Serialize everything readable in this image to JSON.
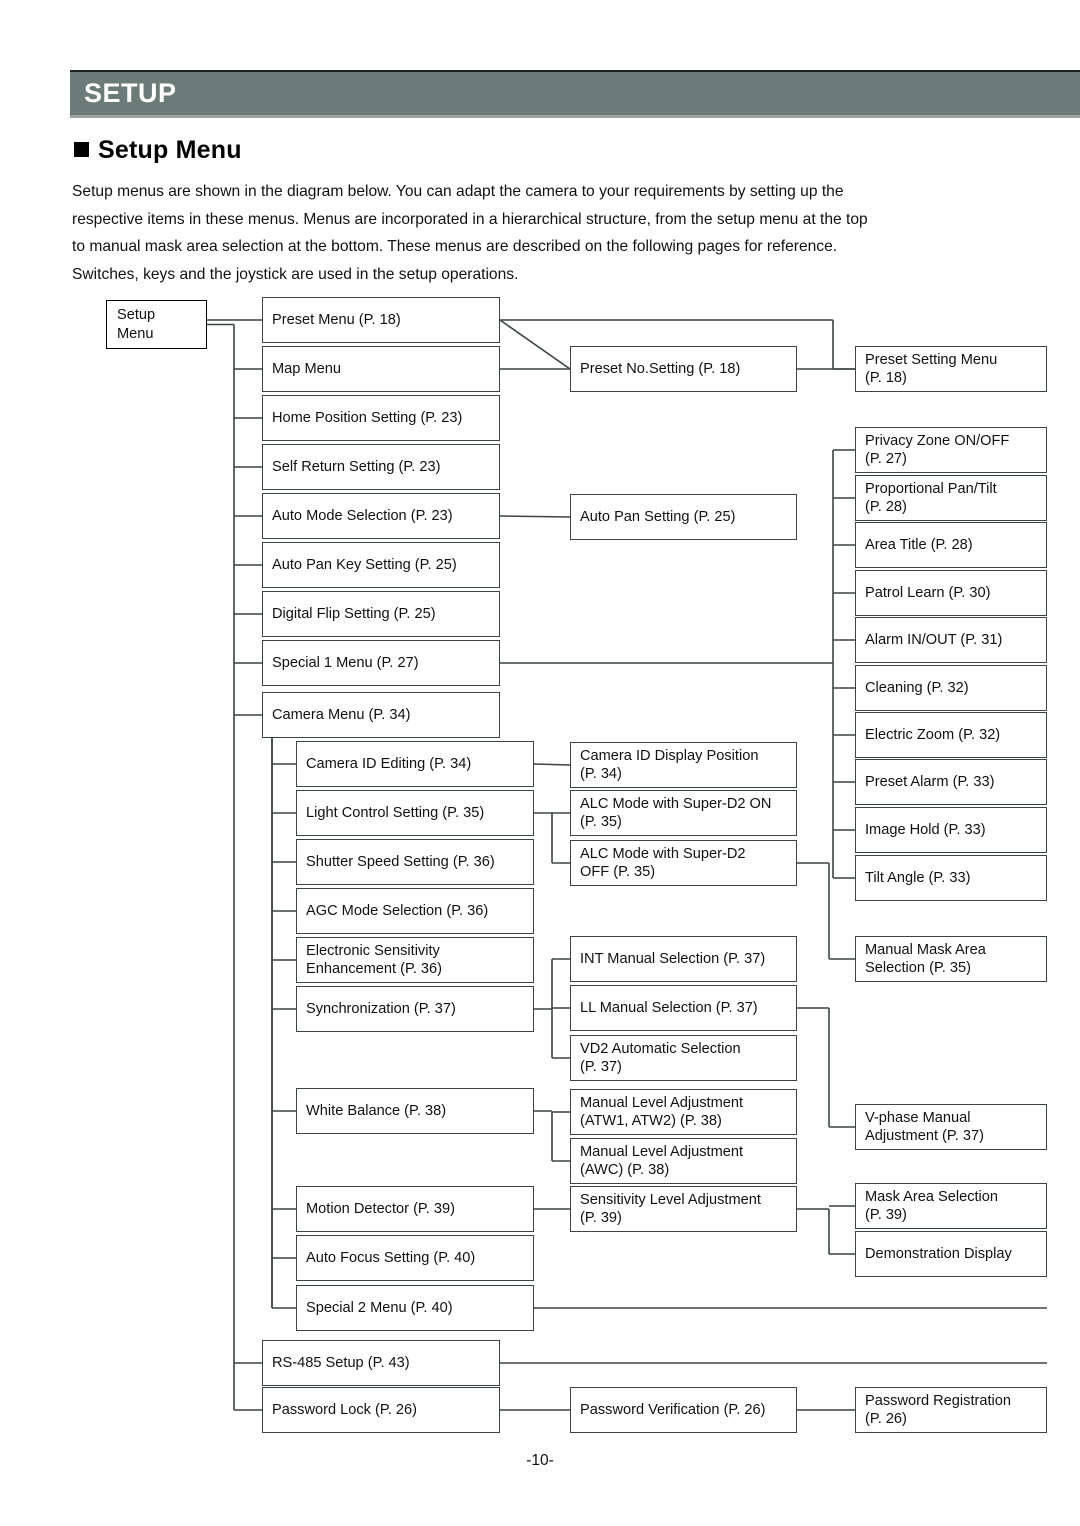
{
  "header": {
    "title": "SETUP"
  },
  "section": {
    "heading": "Setup Menu",
    "bullet_icon": "filled-square-bullet"
  },
  "intro": {
    "line1": "Setup menus are shown in the diagram below. You can adapt the camera to your requirements by setting up the",
    "line2": "respective items in these menus.  Menus are incorporated in a hierarchical structure, from the setup menu at the top",
    "line3": "to manual mask area selection at the bottom. These menus are described on the following pages for reference.",
    "line4": "Switches, keys and the joystick are used in the setup operations."
  },
  "footer": {
    "page_number": "-10-"
  },
  "diagram": {
    "root": {
      "label": "Setup\nMenu"
    },
    "column1": [
      {
        "label": "Preset Menu (P.  18)"
      },
      {
        "label": "Map Menu"
      },
      {
        "label": "Home Position Setting (P.  23)"
      },
      {
        "label": "Self Return Setting (P.  23)"
      },
      {
        "label": "Auto Mode Selection (P.  23)"
      },
      {
        "label": "Auto Pan Key Setting (P.  25)"
      },
      {
        "label": "Digital Flip Setting (P.  25)"
      },
      {
        "label": "Special 1 Menu (P.  27)"
      },
      {
        "label": "Camera Menu (P.  34)"
      },
      {
        "label": "RS-485 Setup (P.  43)"
      },
      {
        "label": "Password Lock (P.  26)"
      }
    ],
    "column2": [
      {
        "label": "Camera ID Editing (P.  34)"
      },
      {
        "label": "Light Control Setting (P.  35)"
      },
      {
        "label": "Shutter Speed Setting (P.  36)"
      },
      {
        "label": "AGC Mode Selection (P.  36)"
      },
      {
        "label": "Electronic Sensitivity\nEnhancement (P.  36)"
      },
      {
        "label": "Synchronization (P.  37)"
      },
      {
        "label": "White Balance (P.  38)"
      },
      {
        "label": "Motion Detector (P.  39)"
      },
      {
        "label": "Auto Focus Setting (P.  40)"
      },
      {
        "label": "Special 2 Menu (P.  40)"
      }
    ],
    "column3": [
      {
        "label": "Preset No.Setting (P.  18)"
      },
      {
        "label": "Auto Pan Setting (P.  25)"
      },
      {
        "label": "Camera ID Display Position\n(P.  34)"
      },
      {
        "label": "ALC Mode with Super-D2 ON\n(P.  35)"
      },
      {
        "label": "ALC Mode with Super-D2\nOFF (P.  35)"
      },
      {
        "label": "INT Manual Selection (P.  37)"
      },
      {
        "label": "LL Manual Selection (P.  37)"
      },
      {
        "label": "VD2 Automatic Selection\n(P.  37)"
      },
      {
        "label": "Manual Level Adjustment\n(ATW1, ATW2) (P.  38)"
      },
      {
        "label": "Manual Level Adjustment\n(AWC) (P.  38)"
      },
      {
        "label": "Sensitivity Level Adjustment\n(P.  39)"
      },
      {
        "label": "Password Verification (P.  26)"
      }
    ],
    "column4": [
      {
        "label": "Preset Setting Menu\n(P.  18)"
      },
      {
        "label": "Privacy Zone ON/OFF\n(P.  27)"
      },
      {
        "label": "Proportional Pan/Tilt\n(P.  28)"
      },
      {
        "label": "Area Title (P.  28)"
      },
      {
        "label": "Patrol Learn (P.  30)"
      },
      {
        "label": "Alarm IN/OUT (P.  31)"
      },
      {
        "label": "Cleaning (P.  32)"
      },
      {
        "label": "Electric Zoom (P.  32)"
      },
      {
        "label": "Preset Alarm (P.  33)"
      },
      {
        "label": "Image Hold (P.  33)"
      },
      {
        "label": "Tilt Angle (P.  33)"
      },
      {
        "label": "Manual Mask Area\nSelection (P.  35)"
      },
      {
        "label": "V-phase Manual\nAdjustment (P.  37)"
      },
      {
        "label": "Mask Area Selection\n(P.  39)"
      },
      {
        "label": "Demonstration Display"
      },
      {
        "label": "Password Registration\n(P.  26)"
      }
    ]
  }
}
